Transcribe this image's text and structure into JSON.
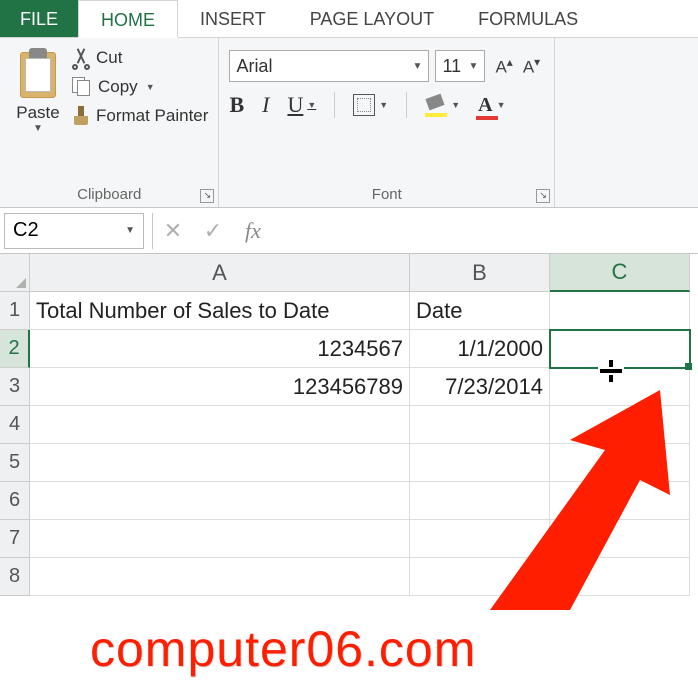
{
  "tabs": {
    "file": "FILE",
    "home": "HOME",
    "insert": "INSERT",
    "page_layout": "PAGE LAYOUT",
    "formulas": "FORMULAS"
  },
  "ribbon": {
    "clipboard": {
      "paste": "Paste",
      "cut": "Cut",
      "copy": "Copy",
      "format_painter": "Format Painter",
      "label": "Clipboard"
    },
    "font": {
      "family": "Arial",
      "size": "11",
      "bold": "B",
      "italic": "I",
      "underline": "U",
      "increase": "A",
      "decrease": "A",
      "color_letter": "A",
      "label": "Font"
    }
  },
  "name_box": "C2",
  "formula_value": "",
  "columns": {
    "A": "A",
    "B": "B",
    "C": "C"
  },
  "rows": [
    "1",
    "2",
    "3",
    "4",
    "5",
    "6",
    "7",
    "8"
  ],
  "grid": {
    "r1": {
      "A": "Total Number of Sales to Date",
      "B": "Date",
      "C": ""
    },
    "r2": {
      "A": "1234567",
      "B": "1/1/2000",
      "C": ""
    },
    "r3": {
      "A": "123456789",
      "B": "7/23/2014",
      "C": ""
    },
    "r4": {
      "A": "",
      "B": "",
      "C": ""
    },
    "r5": {
      "A": "",
      "B": "",
      "C": ""
    },
    "r6": {
      "A": "",
      "B": "",
      "C": ""
    },
    "r7": {
      "A": "",
      "B": "",
      "C": ""
    },
    "r8": {
      "A": "",
      "B": "",
      "C": ""
    }
  },
  "selected_cell": "C2",
  "watermark": "computer06.com"
}
